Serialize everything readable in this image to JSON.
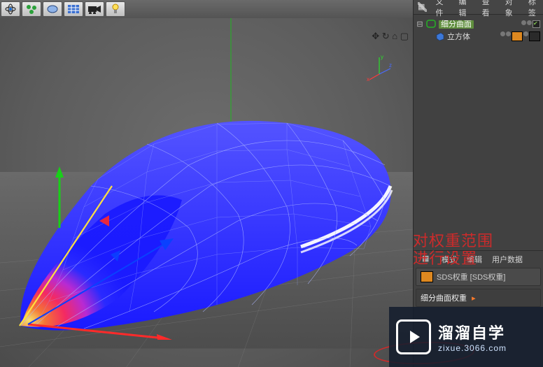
{
  "toolbar": {
    "icons": [
      "atom-icon",
      "molecule-icon",
      "shape-icon",
      "grid-icon",
      "camera-icon",
      "light-icon"
    ]
  },
  "viewport": {
    "nav_icons_text": "✥ ↻ ⌂ ▢",
    "axes": {
      "x": "x",
      "y": "y",
      "z": "z"
    }
  },
  "top_menu": {
    "file": "文件",
    "edit": "编辑",
    "view": "查看",
    "object": "对象",
    "tags": "标签"
  },
  "tree": {
    "parent_label": "细分曲面",
    "child_label": "立方体"
  },
  "attr": {
    "mode": "模式",
    "edit": "编辑",
    "userdata": "用户数据",
    "tag_title": "SDS权重 [SDS权重]",
    "sds_weight_label": "细分曲面权重"
  },
  "annotation": {
    "line1": "对权重范围",
    "line2": "进行设置"
  },
  "watermark": {
    "title": "溜溜自学",
    "url": "zixue.3066.com"
  }
}
